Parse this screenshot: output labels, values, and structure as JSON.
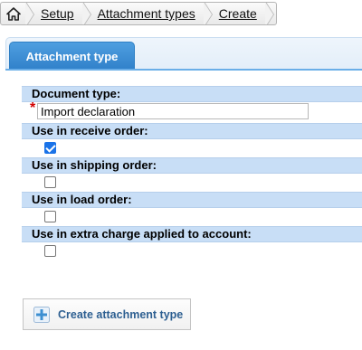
{
  "breadcrumb": {
    "home_icon": "home-icon",
    "items": [
      "Setup",
      "Attachment types",
      "Create"
    ]
  },
  "tab": {
    "label": "Attachment type"
  },
  "form": {
    "document_type": {
      "label": "Document type:",
      "required_mark": "*",
      "value": "Import declaration"
    },
    "receive_order": {
      "label": "Use in receive order:",
      "checked": true
    },
    "shipping_order": {
      "label": "Use in shipping order:",
      "checked": false
    },
    "load_order": {
      "label": "Use in load order:",
      "checked": false
    },
    "extra_charge": {
      "label": "Use in extra charge applied to account:",
      "checked": false
    }
  },
  "button": {
    "label": "Create attachment type",
    "icon": "plus-icon"
  },
  "colors": {
    "tab_bg": "#3a8fd6",
    "row_header_bg": "#c8def6",
    "button_text": "#2d5f91",
    "required": "#d20000"
  }
}
